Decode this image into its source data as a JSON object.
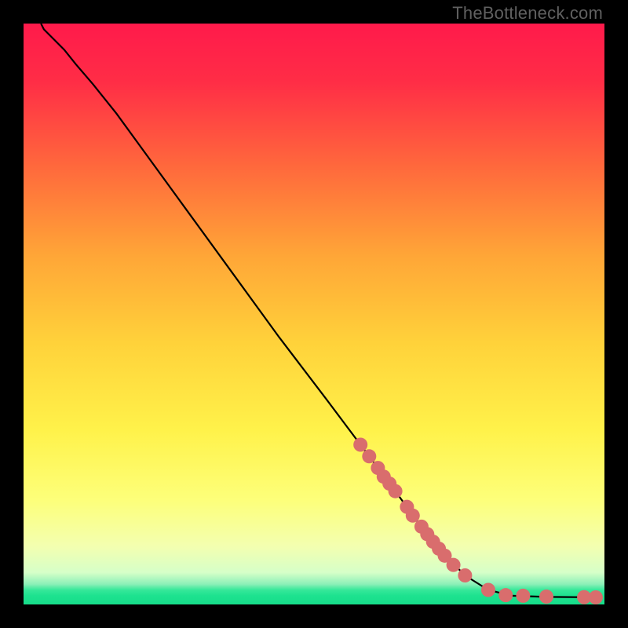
{
  "watermark": "TheBottleneck.com",
  "chart_data": {
    "type": "line",
    "title": "",
    "xlabel": "",
    "ylabel": "",
    "xlim": [
      0,
      100
    ],
    "ylim": [
      0,
      100
    ],
    "background_gradient": {
      "stops": [
        {
          "offset": 0.0,
          "color": "#ff1a4b"
        },
        {
          "offset": 0.1,
          "color": "#ff2d46"
        },
        {
          "offset": 0.25,
          "color": "#ff6a3c"
        },
        {
          "offset": 0.4,
          "color": "#ffa637"
        },
        {
          "offset": 0.55,
          "color": "#ffd23a"
        },
        {
          "offset": 0.7,
          "color": "#fff24a"
        },
        {
          "offset": 0.82,
          "color": "#fdff7a"
        },
        {
          "offset": 0.9,
          "color": "#f3ffb0"
        },
        {
          "offset": 0.945,
          "color": "#d6ffc8"
        },
        {
          "offset": 0.965,
          "color": "#8cf0b8"
        },
        {
          "offset": 0.975,
          "color": "#36e89a"
        },
        {
          "offset": 0.985,
          "color": "#1de28f"
        },
        {
          "offset": 1.0,
          "color": "#17dd8a"
        }
      ]
    },
    "series": [
      {
        "name": "bottleneck-curve",
        "stroke": "#000000",
        "points": [
          {
            "x": 3.0,
            "y": 100.0
          },
          {
            "x": 3.5,
            "y": 99.0
          },
          {
            "x": 5.0,
            "y": 97.5
          },
          {
            "x": 7.0,
            "y": 95.5
          },
          {
            "x": 9.0,
            "y": 93.0
          },
          {
            "x": 12.0,
            "y": 89.5
          },
          {
            "x": 16.0,
            "y": 84.5
          },
          {
            "x": 20.0,
            "y": 79.0
          },
          {
            "x": 28.0,
            "y": 68.0
          },
          {
            "x": 36.0,
            "y": 57.0
          },
          {
            "x": 44.0,
            "y": 46.0
          },
          {
            "x": 52.0,
            "y": 35.5
          },
          {
            "x": 58.0,
            "y": 27.5
          },
          {
            "x": 64.0,
            "y": 19.5
          },
          {
            "x": 68.0,
            "y": 14.0
          },
          {
            "x": 72.0,
            "y": 9.0
          },
          {
            "x": 76.0,
            "y": 5.0
          },
          {
            "x": 80.0,
            "y": 2.5
          },
          {
            "x": 84.0,
            "y": 1.5
          },
          {
            "x": 90.0,
            "y": 1.3
          },
          {
            "x": 96.0,
            "y": 1.25
          },
          {
            "x": 99.0,
            "y": 1.22
          }
        ]
      },
      {
        "name": "data-markers",
        "marker_color": "#d96d6d",
        "marker_radius": 9,
        "points": [
          {
            "x": 58.0,
            "y": 27.5
          },
          {
            "x": 59.5,
            "y": 25.5
          },
          {
            "x": 61.0,
            "y": 23.5
          },
          {
            "x": 62.0,
            "y": 22.0
          },
          {
            "x": 63.0,
            "y": 20.8
          },
          {
            "x": 64.0,
            "y": 19.5
          },
          {
            "x": 66.0,
            "y": 16.8
          },
          {
            "x": 67.0,
            "y": 15.3
          },
          {
            "x": 68.5,
            "y": 13.4
          },
          {
            "x": 69.5,
            "y": 12.1
          },
          {
            "x": 70.5,
            "y": 10.8
          },
          {
            "x": 71.5,
            "y": 9.6
          },
          {
            "x": 72.5,
            "y": 8.4
          },
          {
            "x": 74.0,
            "y": 6.8
          },
          {
            "x": 76.0,
            "y": 5.0
          },
          {
            "x": 80.0,
            "y": 2.5
          },
          {
            "x": 83.0,
            "y": 1.6
          },
          {
            "x": 86.0,
            "y": 1.5
          },
          {
            "x": 90.0,
            "y": 1.35
          },
          {
            "x": 96.5,
            "y": 1.25
          },
          {
            "x": 98.5,
            "y": 1.22
          }
        ]
      }
    ]
  }
}
